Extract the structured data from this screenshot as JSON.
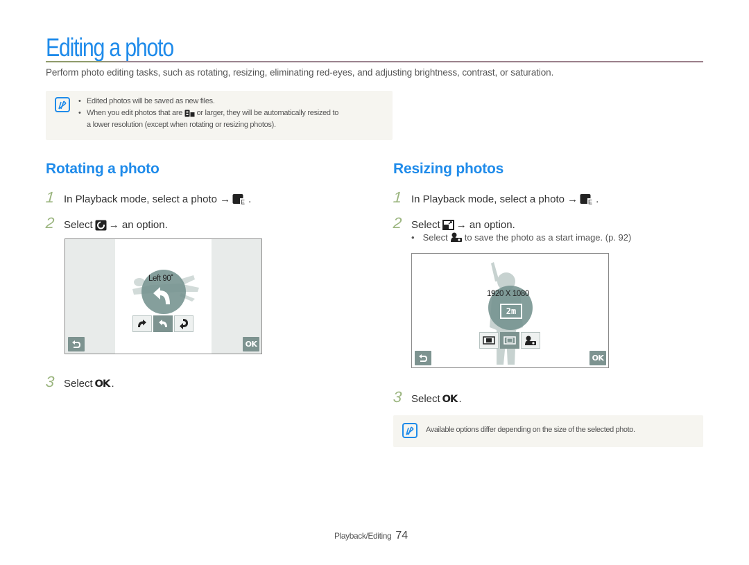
{
  "header": {
    "title": "Editing a photo",
    "intro": "Perform photo editing tasks, such as rotating, resizing, eliminating red-eyes, and adjusting brightness, contrast, or saturation."
  },
  "top_note": {
    "icon": "note-icon",
    "items": [
      "Edited photos will be saved as new files.",
      "When you edit photos that are",
      "or larger, they will be automatically resized to",
      "a lower resolution (except when rotating or resizing photos)."
    ],
    "inline_icon": "8m-resolution-icon"
  },
  "rotating": {
    "title": "Rotating a photo",
    "steps": [
      {
        "num": "1",
        "text": "In Playback mode, select a photo →",
        "icon": "edit-menu-icon",
        "suffix": "."
      },
      {
        "num": "2",
        "text_before": "Select",
        "icon": "rotate-icon",
        "text_after": "→ an option."
      },
      {
        "num": "3",
        "text_before": "Select",
        "icon": "ok-icon",
        "ok_label": "OK",
        "suffix": "."
      }
    ],
    "screen": {
      "dial_label": "Left 90˚",
      "options": [
        "rotate-right-icon",
        "rotate-left-icon",
        "flip-icon"
      ],
      "selected_option": 1,
      "back_icon": "back-icon",
      "ok_label": "OK"
    }
  },
  "resizing": {
    "title": "Resizing photos",
    "steps": [
      {
        "num": "1",
        "text": "In Playback mode, select a photo →",
        "icon": "edit-menu-icon",
        "suffix": "."
      },
      {
        "num": "2",
        "text_before": "Select",
        "icon": "resize-icon",
        "text_after": "→ an option."
      },
      {
        "num": "3",
        "text_before": "Select",
        "icon": "ok-icon",
        "ok_label": "OK",
        "suffix": "."
      }
    ],
    "sub_bullet": {
      "text_before": "Select",
      "icon": "start-image-icon",
      "text_after": "to save the photo as a start image. (p. 92)"
    },
    "screen": {
      "dial_label": "1920 X 1080",
      "dial_value": "2m",
      "options": [
        "4m-icon",
        "2m-icon",
        "start-image-icon"
      ],
      "selected_option": 1,
      "back_icon": "back-icon",
      "ok_label": "OK"
    },
    "note": "Available options differ depending on the size of the selected photo."
  },
  "footer": {
    "section": "Playback/Editing",
    "page": "74"
  },
  "colors": {
    "accent": "#1f8bea",
    "step_number": "#9bb57f",
    "note_bg": "#f6f5f0",
    "camera_ui": "#7d9390"
  }
}
